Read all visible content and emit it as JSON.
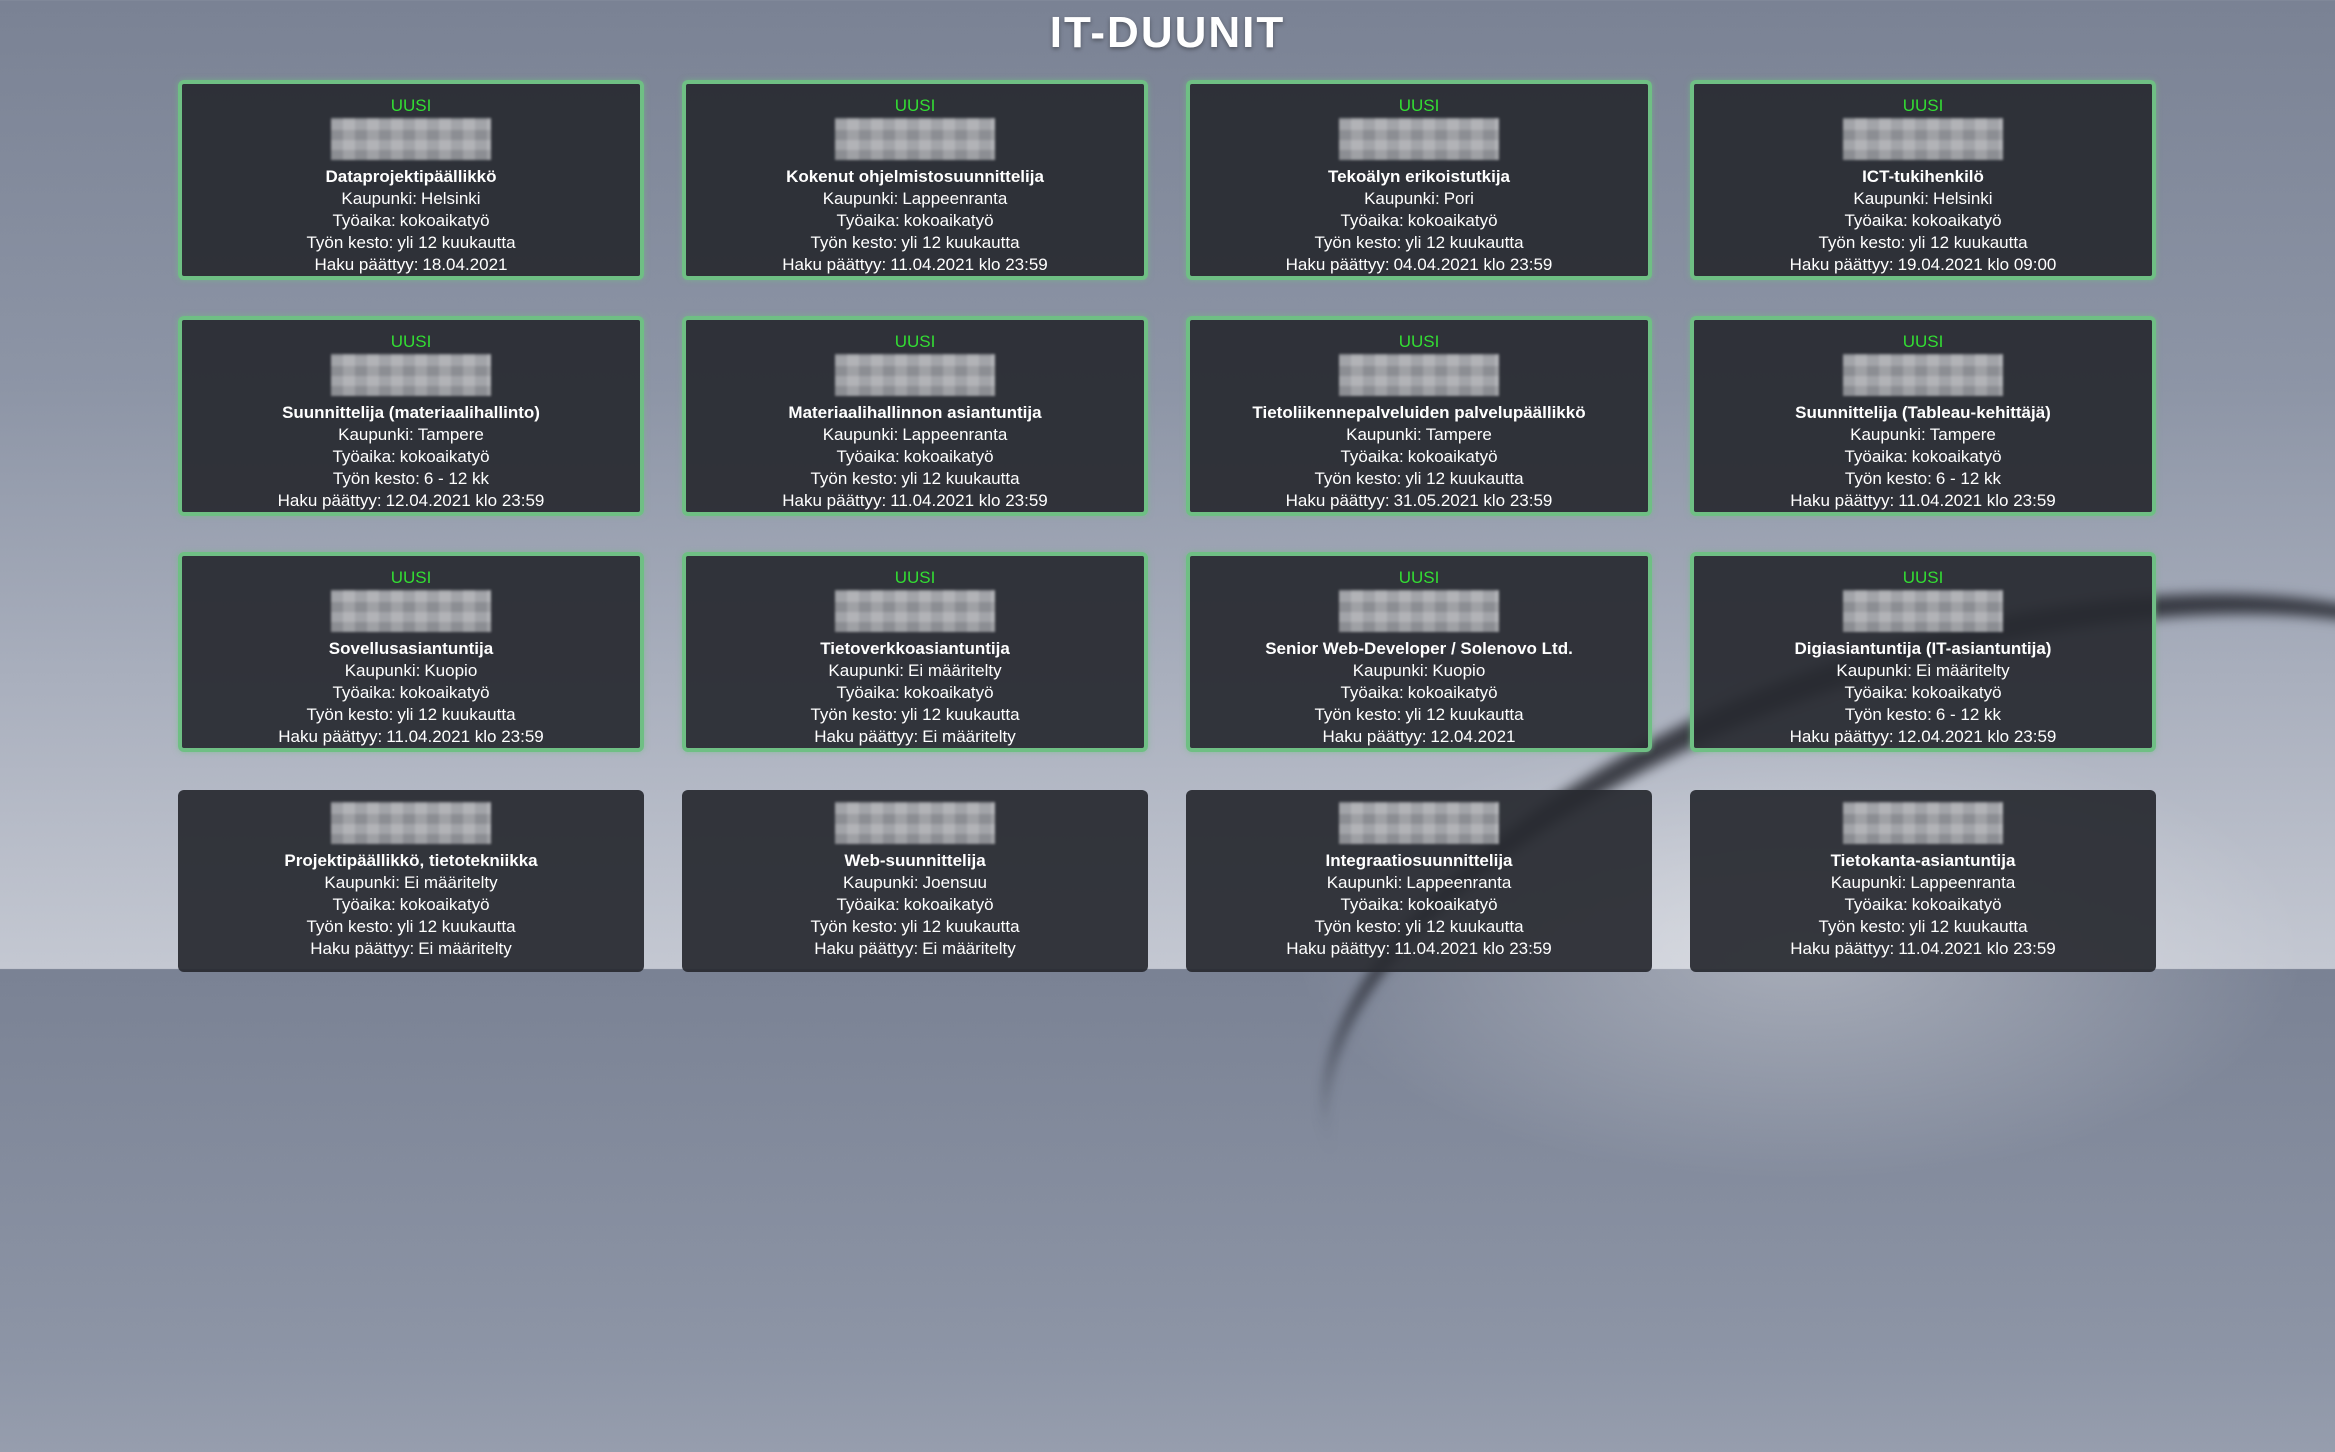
{
  "page_title": "IT-DUUNIT",
  "labels": {
    "city": "Kaupunki:",
    "worktime": "Työaika:",
    "duration": "Työn kesto:",
    "deadline": "Haku päättyy:"
  },
  "jobs": [
    {
      "badge": "UUSI",
      "title": "Dataprojektipäällikkö",
      "city": "Helsinki",
      "worktime": "kokoaikatyö",
      "duration": "yli 12 kuukautta",
      "deadline": "18.04.2021"
    },
    {
      "badge": "UUSI",
      "title": "Kokenut ohjelmistosuunnittelija",
      "city": "Lappeenranta",
      "worktime": "kokoaikatyö",
      "duration": "yli 12 kuukautta",
      "deadline": "11.04.2021 klo 23:59"
    },
    {
      "badge": "UUSI",
      "title": "Tekoälyn erikoistutkija",
      "city": "Pori",
      "worktime": "kokoaikatyö",
      "duration": "yli 12 kuukautta",
      "deadline": "04.04.2021 klo 23:59"
    },
    {
      "badge": "UUSI",
      "title": "ICT-tukihenkilö",
      "city": "Helsinki",
      "worktime": "kokoaikatyö",
      "duration": "yli 12 kuukautta",
      "deadline": "19.04.2021 klo 09:00"
    },
    {
      "badge": "UUSI",
      "title": "Suunnittelija (materiaalihallinto)",
      "city": "Tampere",
      "worktime": "kokoaikatyö",
      "duration": "6 - 12 kk",
      "deadline": "12.04.2021 klo 23:59"
    },
    {
      "badge": "UUSI",
      "title": "Materiaalihallinnon asiantuntija",
      "city": "Lappeenranta",
      "worktime": "kokoaikatyö",
      "duration": "yli 12 kuukautta",
      "deadline": "11.04.2021 klo 23:59"
    },
    {
      "badge": "UUSI",
      "title": "Tietoliikennepalveluiden palvelupäällikkö",
      "city": "Tampere",
      "worktime": "kokoaikatyö",
      "duration": "yli 12 kuukautta",
      "deadline": "31.05.2021 klo 23:59"
    },
    {
      "badge": "UUSI",
      "title": "Suunnittelija (Tableau-kehittäjä)",
      "city": "Tampere",
      "worktime": "kokoaikatyö",
      "duration": "6 - 12 kk",
      "deadline": "11.04.2021 klo 23:59"
    },
    {
      "badge": "UUSI",
      "title": "Sovellusasiantuntija",
      "city": "Kuopio",
      "worktime": "kokoaikatyö",
      "duration": "yli 12 kuukautta",
      "deadline": "11.04.2021 klo 23:59"
    },
    {
      "badge": "UUSI",
      "title": "Tietoverkkoasiantuntija",
      "city": "Ei määritelty",
      "worktime": "kokoaikatyö",
      "duration": "yli 12 kuukautta",
      "deadline": "Ei määritelty"
    },
    {
      "badge": "UUSI",
      "title": "Senior Web-Developer / Solenovo Ltd.",
      "city": "Kuopio",
      "worktime": "kokoaikatyö",
      "duration": "yli 12 kuukautta",
      "deadline": "12.04.2021"
    },
    {
      "badge": "UUSI",
      "title": "Digiasiantuntija (IT-asiantuntija)",
      "city": "Ei määritelty",
      "worktime": "kokoaikatyö",
      "duration": "6 - 12 kk",
      "deadline": "12.04.2021 klo 23:59"
    },
    {
      "badge": "",
      "title": "Projektipäällikkö, tietotekniikka",
      "city": "Ei määritelty",
      "worktime": "kokoaikatyö",
      "duration": "yli 12 kuukautta",
      "deadline": "Ei määritelty"
    },
    {
      "badge": "",
      "title": "Web-suunnittelija",
      "city": "Joensuu",
      "worktime": "kokoaikatyö",
      "duration": "yli 12 kuukautta",
      "deadline": "Ei määritelty"
    },
    {
      "badge": "",
      "title": "Integraatiosuunnittelija",
      "city": "Lappeenranta",
      "worktime": "kokoaikatyö",
      "duration": "yli 12 kuukautta",
      "deadline": "11.04.2021 klo 23:59"
    },
    {
      "badge": "",
      "title": "Tietokanta-asiantuntija",
      "city": "Lappeenranta",
      "worktime": "kokoaikatyö",
      "duration": "yli 12 kuukautta",
      "deadline": "11.04.2021 klo 23:59"
    }
  ],
  "colors": {
    "new_badge": "#33dd33",
    "new_border": "#6fbf84",
    "card_bg": "#2b2d33"
  }
}
